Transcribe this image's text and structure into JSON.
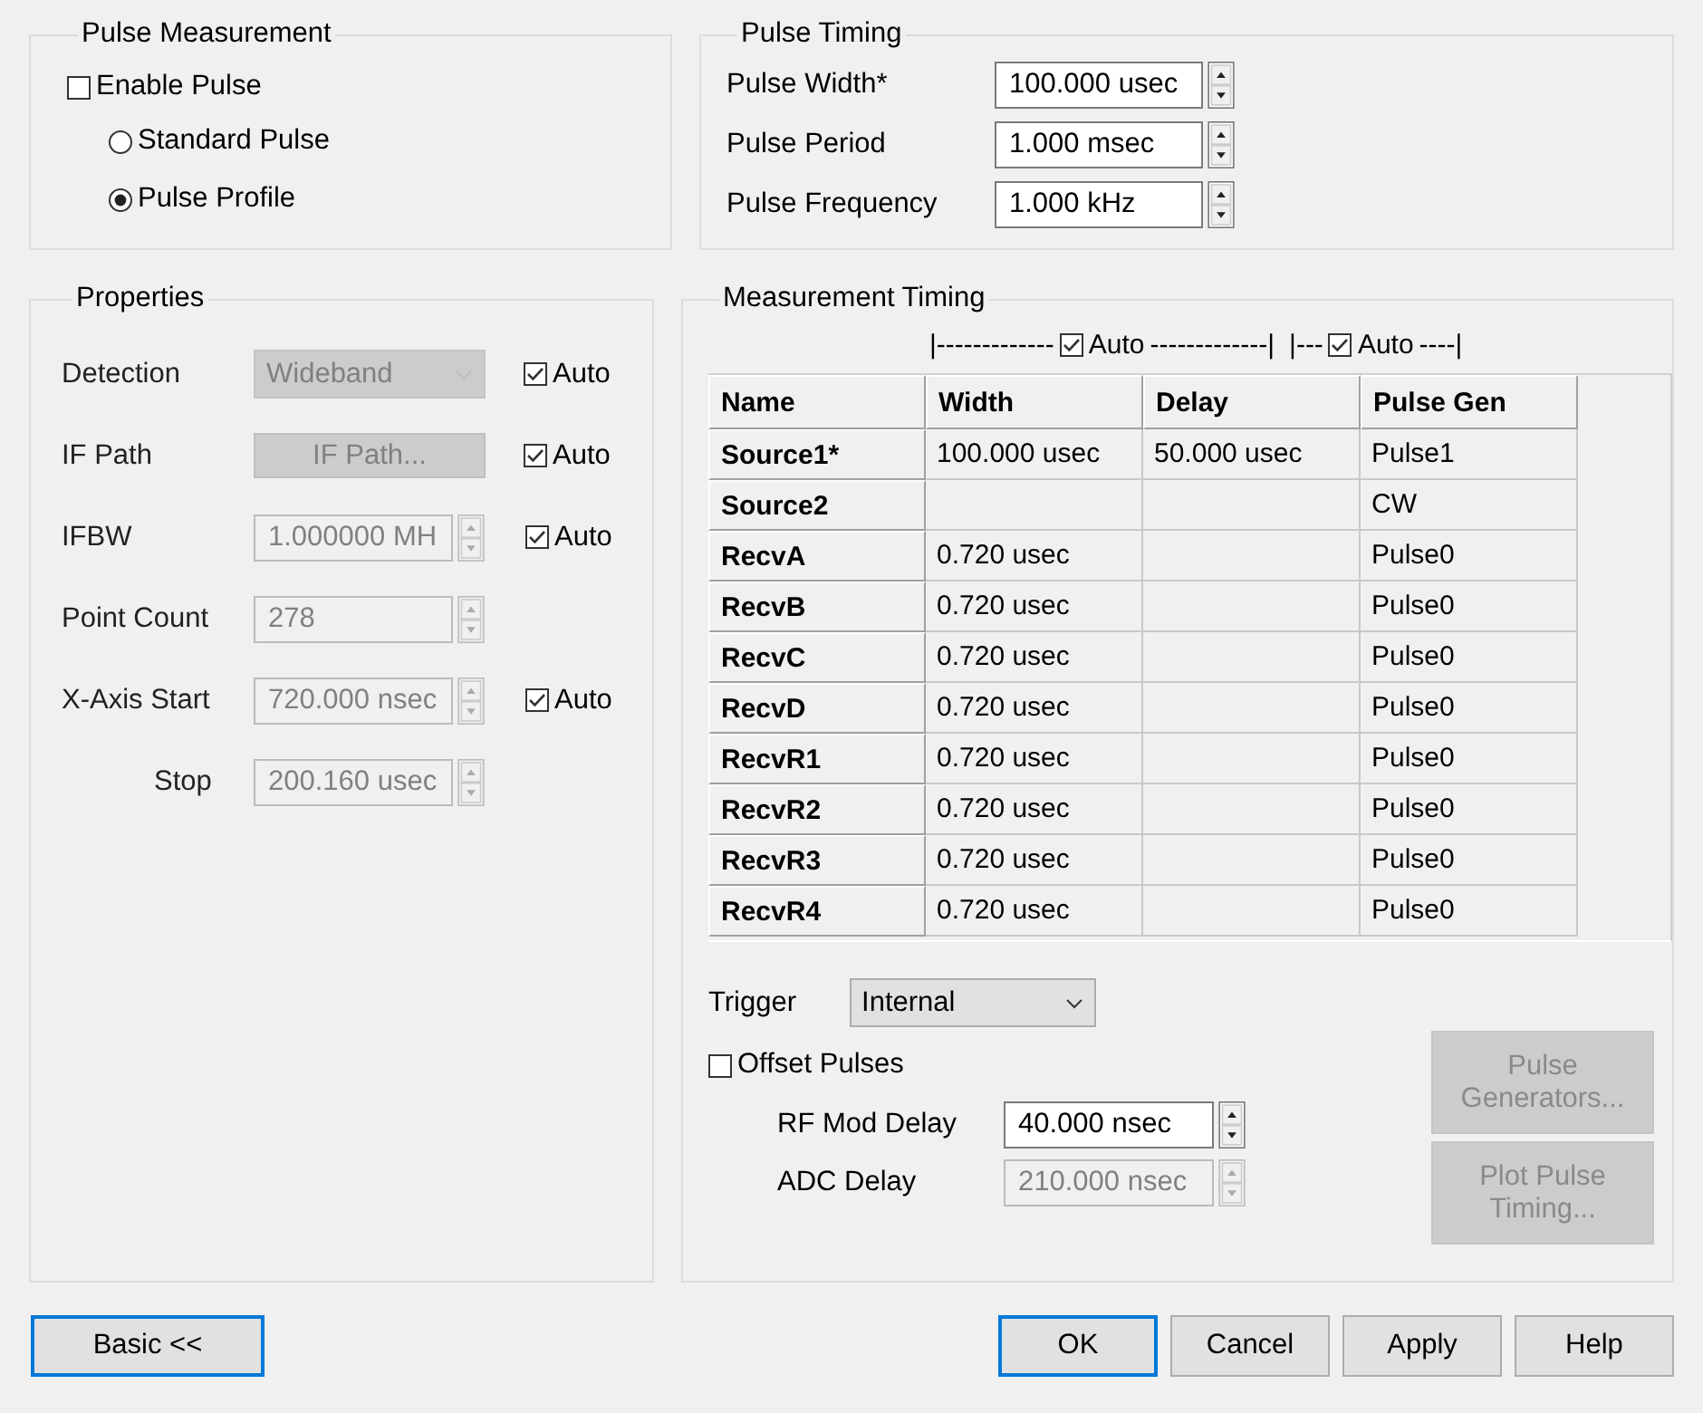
{
  "pulse_measurement": {
    "title": "Pulse Measurement",
    "enable": {
      "label": "Enable Pulse",
      "checked": false
    },
    "modes": [
      {
        "label": "Standard Pulse",
        "selected": false
      },
      {
        "label": "Pulse Profile",
        "selected": true
      }
    ]
  },
  "pulse_timing": {
    "title": "Pulse Timing",
    "rows": [
      {
        "label": "Pulse Width*",
        "value": "100.000 usec"
      },
      {
        "label": "Pulse Period",
        "value": "1.000 msec"
      },
      {
        "label": "Pulse Frequency",
        "value": "1.000 kHz"
      }
    ]
  },
  "properties": {
    "title": "Properties",
    "rows": [
      {
        "kind": "dropdown",
        "label": "Detection",
        "value": "Wideband",
        "disabled": true,
        "sub": false,
        "auto": {
          "label": "Auto",
          "checked": true
        }
      },
      {
        "kind": "button",
        "label": "IF Path",
        "value": "IF Path...",
        "disabled": true,
        "sub": false,
        "auto": {
          "label": "Auto",
          "checked": true
        }
      },
      {
        "kind": "spin",
        "label": "IFBW",
        "value": "1.000000 MH",
        "disabled": true,
        "sub": false,
        "auto": {
          "label": "Auto",
          "checked": true
        }
      },
      {
        "kind": "spin",
        "label": "Point Count",
        "value": "278",
        "disabled": true,
        "sub": false
      },
      {
        "kind": "spin",
        "label": "X-Axis Start",
        "value": "720.000 nsec",
        "disabled": true,
        "sub": false,
        "auto": {
          "label": "Auto",
          "checked": true
        }
      },
      {
        "kind": "spin",
        "label": "Stop",
        "value": "200.160 usec",
        "disabled": true,
        "sub": true
      }
    ]
  },
  "measurement_timing": {
    "title": "Measurement Timing",
    "auto_groups": [
      {
        "prefix": "|-------------",
        "label": "Auto",
        "checked": true,
        "suffix": "-------------|"
      },
      {
        "prefix": "|---",
        "label": "Auto",
        "checked": true,
        "suffix": "----|"
      }
    ],
    "table": {
      "columns": [
        "Name",
        "Width",
        "Delay",
        "Pulse Gen"
      ],
      "rows": [
        [
          "Source1*",
          "100.000 usec",
          "50.000 usec",
          "Pulse1"
        ],
        [
          "Source2",
          "",
          "",
          "CW"
        ],
        [
          "RecvA",
          "0.720 usec",
          "",
          "Pulse0"
        ],
        [
          "RecvB",
          "0.720 usec",
          "",
          "Pulse0"
        ],
        [
          "RecvC",
          "0.720 usec",
          "",
          "Pulse0"
        ],
        [
          "RecvD",
          "0.720 usec",
          "",
          "Pulse0"
        ],
        [
          "RecvR1",
          "0.720 usec",
          "",
          "Pulse0"
        ],
        [
          "RecvR2",
          "0.720 usec",
          "",
          "Pulse0"
        ],
        [
          "RecvR3",
          "0.720 usec",
          "",
          "Pulse0"
        ],
        [
          "RecvR4",
          "0.720 usec",
          "",
          "Pulse0"
        ]
      ]
    },
    "trigger": {
      "label": "Trigger",
      "value": "Internal"
    },
    "offset_pulses": {
      "label": "Offset Pulses",
      "checked": false
    },
    "delays": [
      {
        "label": "RF Mod Delay",
        "value": "40.000 nsec",
        "disabled": false
      },
      {
        "label": "ADC Delay",
        "value": "210.000 nsec",
        "disabled": true
      }
    ],
    "side_buttons": [
      {
        "label": "Pulse Generators...",
        "disabled": true
      },
      {
        "label": "Plot Pulse Timing...",
        "disabled": true
      }
    ]
  },
  "buttons_left": [
    {
      "label": "Basic <<",
      "focused": true
    }
  ],
  "buttons_right": [
    {
      "label": "OK",
      "focused": true
    },
    {
      "label": "Cancel",
      "focused": false
    },
    {
      "label": "Apply",
      "focused": false
    },
    {
      "label": "Help",
      "focused": false
    }
  ]
}
